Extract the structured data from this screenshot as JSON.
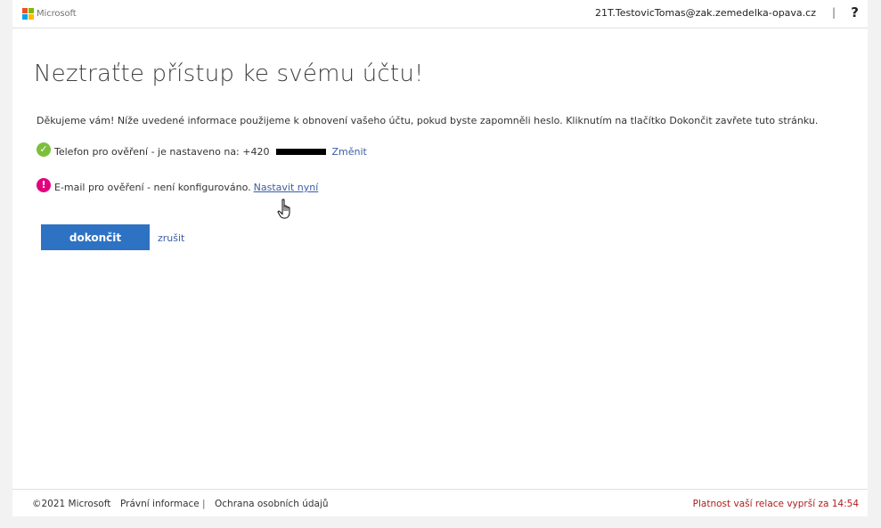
{
  "header": {
    "logo_text": "Microsoft",
    "user_email": "21T.TestovicTomas@zak.zemedelka-opava.cz",
    "separator": "|",
    "help_label": "?"
  },
  "main": {
    "title": "Neztraťte přístup ke svému účtu!",
    "intro": "Děkujeme vám! Níže uvedené informace použijeme k obnovení vašeho účtu, pokud byste zapomněli heslo. Kliknutím na tlačítko Dokončit zavřete tuto stránku.",
    "phone": {
      "icon": "check-circle-icon",
      "text": "Telefon pro ověření - je nastaveno na: +420",
      "link": "Změnit"
    },
    "email": {
      "icon": "exclamation-circle-icon",
      "text": "E-mail pro ověření - není konfigurováno.",
      "link": "Nastavit nyní"
    },
    "finish_label": "dokončit",
    "cancel_label": "zrušit"
  },
  "footer": {
    "copyright": "©2021 Microsoft",
    "legal": "Právní informace",
    "separator": "|",
    "privacy": "Ochrana osobních údajů",
    "session": "Platnost vaší relace vyprší za 14:54"
  },
  "colors": {
    "accent": "#2e72c4",
    "link": "#3b5da6",
    "success": "#7cbf3c",
    "warning": "#e3007e",
    "session_text": "#b01c1c"
  }
}
